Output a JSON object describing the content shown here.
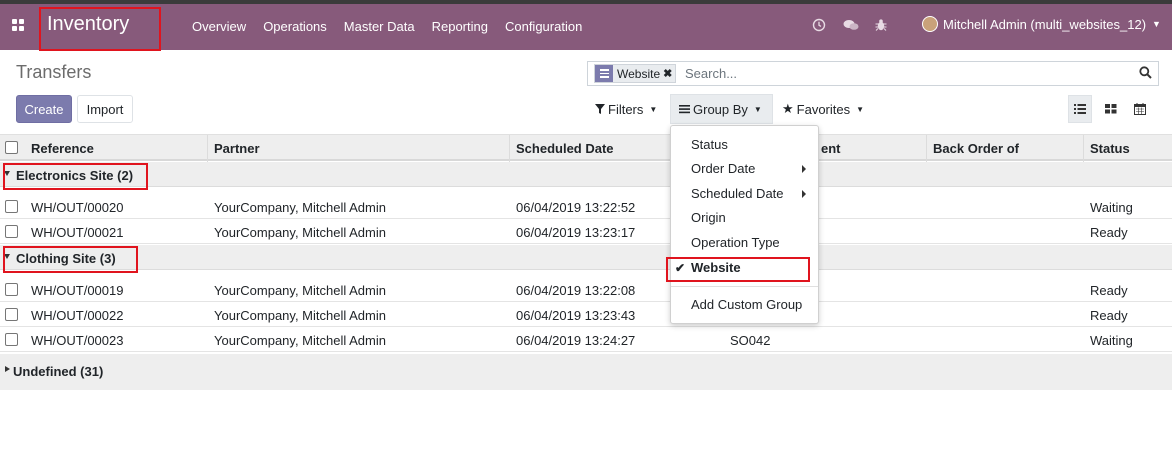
{
  "app": {
    "title": "Inventory"
  },
  "nav": {
    "menu": [
      "Overview",
      "Operations",
      "Master Data",
      "Reporting",
      "Configuration"
    ],
    "icons": [
      "clock-icon",
      "chat-icon",
      "bug-icon"
    ],
    "user": "Mitchell Admin (multi_websites_12)"
  },
  "control": {
    "breadcrumb": "Transfers",
    "create_label": "Create",
    "import_label": "Import",
    "facet_label": "Website",
    "facet_remove": "✖",
    "search_placeholder": "Search...",
    "filters_label": "Filters",
    "groupby_label": "Group By",
    "favorites_label": "Favorites"
  },
  "groupby_menu": {
    "items": [
      "Status",
      "Order Date",
      "Scheduled Date",
      "Origin",
      "Operation Type",
      "Website"
    ],
    "selected": "Website",
    "custom": "Add Custom Group"
  },
  "table": {
    "columns": [
      "Reference",
      "Partner",
      "Scheduled Date",
      "ent",
      "Back Order of",
      "Status"
    ],
    "groups": [
      {
        "label": "Electronics Site (2)",
        "expanded": true,
        "rows": [
          {
            "reference": "WH/OUT/00020",
            "partner": "YourCompany, Mitchell Admin",
            "date": "06/04/2019 13:22:52",
            "source": "",
            "status": "Waiting"
          },
          {
            "reference": "WH/OUT/00021",
            "partner": "YourCompany, Mitchell Admin",
            "date": "06/04/2019 13:23:17",
            "source": "",
            "status": "Ready"
          }
        ]
      },
      {
        "label": "Clothing Site (3)",
        "expanded": true,
        "rows": [
          {
            "reference": "WH/OUT/00019",
            "partner": "YourCompany, Mitchell Admin",
            "date": "06/04/2019 13:22:08",
            "source": "",
            "status": "Ready"
          },
          {
            "reference": "WH/OUT/00022",
            "partner": "YourCompany, Mitchell Admin",
            "date": "06/04/2019 13:23:43",
            "source": "",
            "status": "Ready"
          },
          {
            "reference": "WH/OUT/00023",
            "partner": "YourCompany, Mitchell Admin",
            "date": "06/04/2019 13:24:27",
            "source": "SO042",
            "status": "Waiting"
          }
        ]
      },
      {
        "label": "Undefined (31)",
        "expanded": false,
        "rows": []
      }
    ]
  },
  "colors": {
    "nav": "#875A7B",
    "primary": "#7C7BAD",
    "highlight": "#e0141e"
  }
}
